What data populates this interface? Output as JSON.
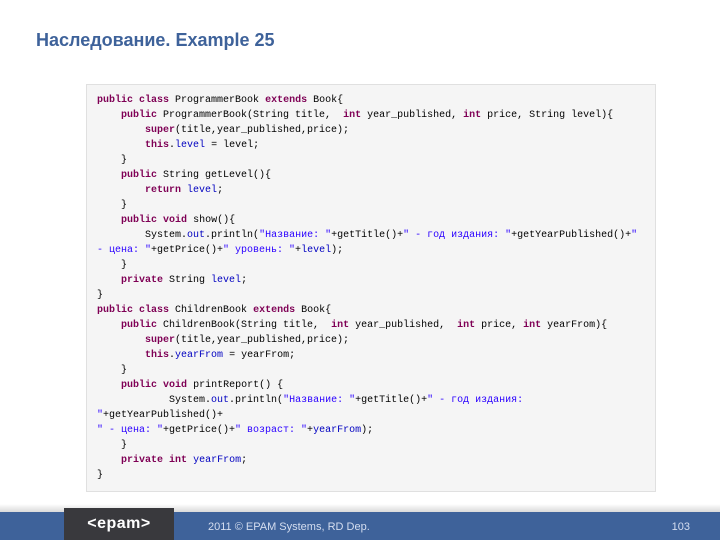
{
  "title": "Наследование. Example 25",
  "footer": {
    "logo": "<epam>",
    "copyright": "2011 © EPAM Systems, RD Dep.",
    "page": "103"
  },
  "code": {
    "l01a": "public",
    "l01b": "class",
    "l01c": " ProgrammerBook ",
    "l01d": "extends",
    "l01e": " Book{",
    "l02a": "    ",
    "l02b": "public",
    "l02c": " ProgrammerBook(String title,  ",
    "l02d": "int",
    "l02e": " year_published, ",
    "l02f": "int",
    "l02g": " price, String level){",
    "l03a": "        ",
    "l03b": "super",
    "l03c": "(title,year_published,price);",
    "l04a": "        ",
    "l04b": "this",
    "l04c": ".",
    "l04d": "level",
    "l04e": " = level;",
    "l05": "    }",
    "l06a": "    ",
    "l06b": "public",
    "l06c": " String getLevel(){",
    "l07a": "        ",
    "l07b": "return",
    "l07c": " ",
    "l07d": "level",
    "l07e": ";",
    "l08": "    }",
    "l09a": "    ",
    "l09b": "public",
    "l09c": " ",
    "l09d": "void",
    "l09e": " show(){",
    "l10a": "        System.",
    "l10b": "out",
    "l10c": ".println(",
    "l10d": "\"Название: \"",
    "l10e": "+getTitle()+",
    "l10f": "\" - год издания: \"",
    "l10g": "+getYearPublished()+",
    "l10h": "\" - цена: \"",
    "l10i": "+getPrice()+",
    "l10j": "\" уровень: \"",
    "l10k": "+",
    "l10l": "level",
    "l10m": ");",
    "l11": "    }",
    "l12a": "    ",
    "l12b": "private",
    "l12c": " String ",
    "l12d": "level",
    "l12e": ";",
    "l13": "}",
    "l14a": "public",
    "l14b": "class",
    "l14c": " ChildrenBook ",
    "l14d": "extends",
    "l14e": " Book{",
    "l15a": "    ",
    "l15b": "public",
    "l15c": " ChildrenBook(String title,  ",
    "l15d": "int",
    "l15e": " year_published,  ",
    "l15f": "int",
    "l15g": " price, ",
    "l15h": "int",
    "l15i": " yearFrom){",
    "l16a": "        ",
    "l16b": "super",
    "l16c": "(title,year_published,price);",
    "l17a": "        ",
    "l17b": "this",
    "l17c": ".",
    "l17d": "yearFrom",
    "l17e": " = yearFrom;",
    "l18": "    }",
    "l19a": "    ",
    "l19b": "public",
    "l19c": " ",
    "l19d": "void",
    "l19e": " printReport() {",
    "l20a": "            System.",
    "l20b": "out",
    "l20c": ".println(",
    "l20d": "\"Название: \"",
    "l20e": "+getTitle()+",
    "l20f": "\" - год издания: \"",
    "l20g": "+getYearPublished()+",
    "l21a": "\" - цена: \"",
    "l21b": "+getPrice()+",
    "l21c": "\" возраст: \"",
    "l21d": "+",
    "l21e": "yearFrom",
    "l21f": ");",
    "l22": "    }",
    "l23a": "    ",
    "l23b": "private",
    "l23c": " ",
    "l23d": "int",
    "l23e": " ",
    "l23f": "yearFrom",
    "l23g": ";",
    "l24": "}"
  }
}
